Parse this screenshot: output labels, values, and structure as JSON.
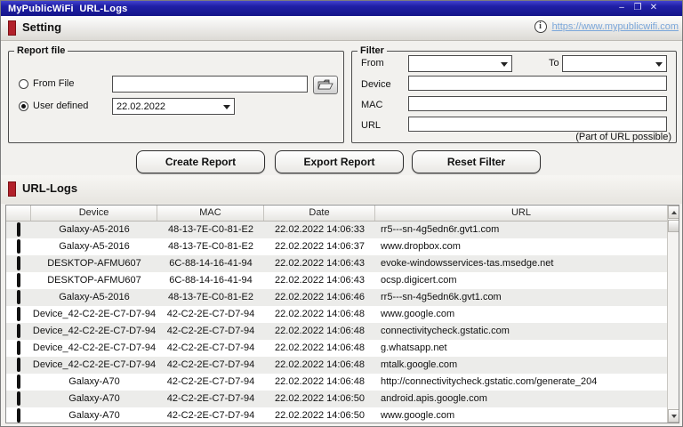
{
  "window": {
    "title": "MyPublicWiFi  URL-Logs",
    "controls": {
      "minimize": "–",
      "maximize": "❐",
      "close": "✕"
    }
  },
  "colors": {
    "titlebar": "#1b1b97",
    "accent_red": "#b2212b",
    "link_blue": "#7aa6d9"
  },
  "setting": {
    "section_title": "Setting",
    "link": "https://www.mypublicwifi.com"
  },
  "report_file": {
    "group_label": "Report file",
    "from_file_label": "From File",
    "from_file_value": "",
    "user_defined_label": "User defined",
    "user_defined_selected": true,
    "date_value": "22.02.2022"
  },
  "filter": {
    "group_label": "Filter",
    "from_label": "From",
    "from_value": "",
    "to_label": "To",
    "to_value": "",
    "device_label": "Device",
    "device_value": "",
    "mac_label": "MAC",
    "mac_value": "",
    "url_label": "URL",
    "url_value": "",
    "hint": "(Part of URL possible)"
  },
  "buttons": {
    "create_report": "Create Report",
    "export_report": "Export Report",
    "reset_filter": "Reset Filter"
  },
  "logs": {
    "section_title": "URL-Logs",
    "columns": {
      "device": "Device",
      "mac": "MAC",
      "date": "Date",
      "url": "URL"
    },
    "rows": [
      {
        "device": "Galaxy-A5-2016",
        "mac": "48-13-7E-C0-81-E2",
        "date": "22.02.2022 14:06:33",
        "url": "rr5---sn-4g5edn6r.gvt1.com"
      },
      {
        "device": "Galaxy-A5-2016",
        "mac": "48-13-7E-C0-81-E2",
        "date": "22.02.2022 14:06:37",
        "url": "www.dropbox.com"
      },
      {
        "device": "DESKTOP-AFMU607",
        "mac": "6C-88-14-16-41-94",
        "date": "22.02.2022 14:06:43",
        "url": "evoke-windowsservices-tas.msedge.net"
      },
      {
        "device": "DESKTOP-AFMU607",
        "mac": "6C-88-14-16-41-94",
        "date": "22.02.2022 14:06:43",
        "url": "ocsp.digicert.com"
      },
      {
        "device": "Galaxy-A5-2016",
        "mac": "48-13-7E-C0-81-E2",
        "date": "22.02.2022 14:06:46",
        "url": "rr5---sn-4g5edn6k.gvt1.com"
      },
      {
        "device": "Device_42-C2-2E-C7-D7-94",
        "mac": "42-C2-2E-C7-D7-94",
        "date": "22.02.2022 14:06:48",
        "url": "www.google.com"
      },
      {
        "device": "Device_42-C2-2E-C7-D7-94",
        "mac": "42-C2-2E-C7-D7-94",
        "date": "22.02.2022 14:06:48",
        "url": "connectivitycheck.gstatic.com"
      },
      {
        "device": "Device_42-C2-2E-C7-D7-94",
        "mac": "42-C2-2E-C7-D7-94",
        "date": "22.02.2022 14:06:48",
        "url": "g.whatsapp.net"
      },
      {
        "device": "Device_42-C2-2E-C7-D7-94",
        "mac": "42-C2-2E-C7-D7-94",
        "date": "22.02.2022 14:06:48",
        "url": "mtalk.google.com"
      },
      {
        "device": "Galaxy-A70",
        "mac": "42-C2-2E-C7-D7-94",
        "date": "22.02.2022 14:06:48",
        "url": "http://connectivitycheck.gstatic.com/generate_204"
      },
      {
        "device": "Galaxy-A70",
        "mac": "42-C2-2E-C7-D7-94",
        "date": "22.02.2022 14:06:50",
        "url": "android.apis.google.com"
      },
      {
        "device": "Galaxy-A70",
        "mac": "42-C2-2E-C7-D7-94",
        "date": "22.02.2022 14:06:50",
        "url": "www.google.com"
      }
    ]
  }
}
